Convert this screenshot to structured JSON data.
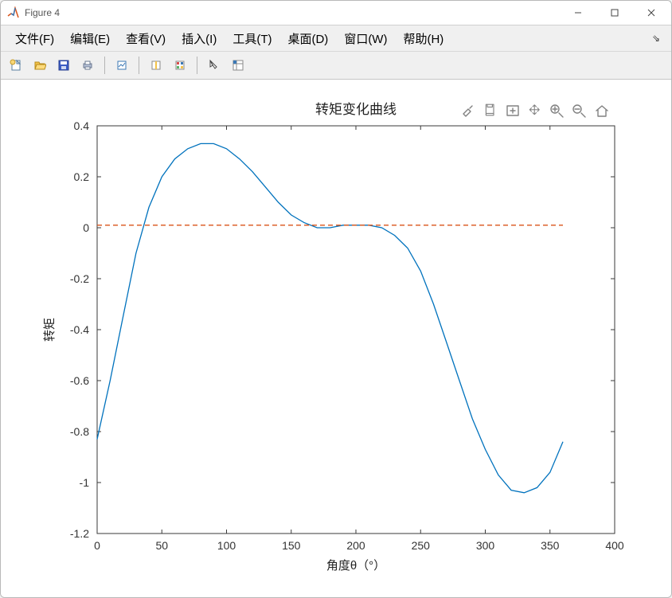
{
  "window": {
    "title": "Figure 4"
  },
  "menu": {
    "items": [
      "文件(F)",
      "编辑(E)",
      "查看(V)",
      "插入(I)",
      "工具(T)",
      "桌面(D)",
      "窗口(W)",
      "帮助(H)"
    ]
  },
  "toolbar_icons": [
    "new",
    "open",
    "save",
    "print",
    "|",
    "print-figure",
    "|",
    "data-cursor",
    "colorbar",
    "|",
    "pointer",
    "insert-box"
  ],
  "axes_toolbar_icons": [
    "brush",
    "save-axes",
    "pan-constrained",
    "pan",
    "zoom-in",
    "zoom-out",
    "home"
  ],
  "chart_data": {
    "type": "line",
    "title": "转矩变化曲线",
    "xlabel": "角度θ（°）",
    "ylabel": "转矩",
    "xlim": [
      0,
      400
    ],
    "ylim": [
      -1.2,
      0.4
    ],
    "xticks": [
      0,
      50,
      100,
      150,
      200,
      250,
      300,
      350,
      400
    ],
    "yticks": [
      -1.2,
      -1,
      -0.8,
      -0.6,
      -0.4,
      -0.2,
      0,
      0.2,
      0.4
    ],
    "series": [
      {
        "name": "curve",
        "color": "#0072BD",
        "x": [
          0,
          10,
          20,
          30,
          40,
          50,
          60,
          70,
          80,
          90,
          100,
          110,
          120,
          130,
          140,
          150,
          160,
          170,
          180,
          190,
          200,
          210,
          220,
          230,
          240,
          250,
          260,
          270,
          280,
          290,
          300,
          310,
          320,
          330,
          340,
          350,
          360
        ],
        "y": [
          -0.83,
          -0.6,
          -0.35,
          -0.1,
          0.08,
          0.2,
          0.27,
          0.31,
          0.33,
          0.33,
          0.31,
          0.27,
          0.22,
          0.16,
          0.1,
          0.05,
          0.02,
          0.0,
          0.0,
          0.01,
          0.01,
          0.01,
          0.0,
          -0.03,
          -0.08,
          -0.17,
          -0.3,
          -0.45,
          -0.6,
          -0.75,
          -0.87,
          -0.97,
          -1.03,
          -1.04,
          -1.02,
          -0.96,
          -0.84
        ]
      },
      {
        "name": "ref-line",
        "color": "#D95319",
        "dash": true,
        "x": [
          0,
          360
        ],
        "y": [
          0.01,
          0.01
        ]
      }
    ]
  }
}
